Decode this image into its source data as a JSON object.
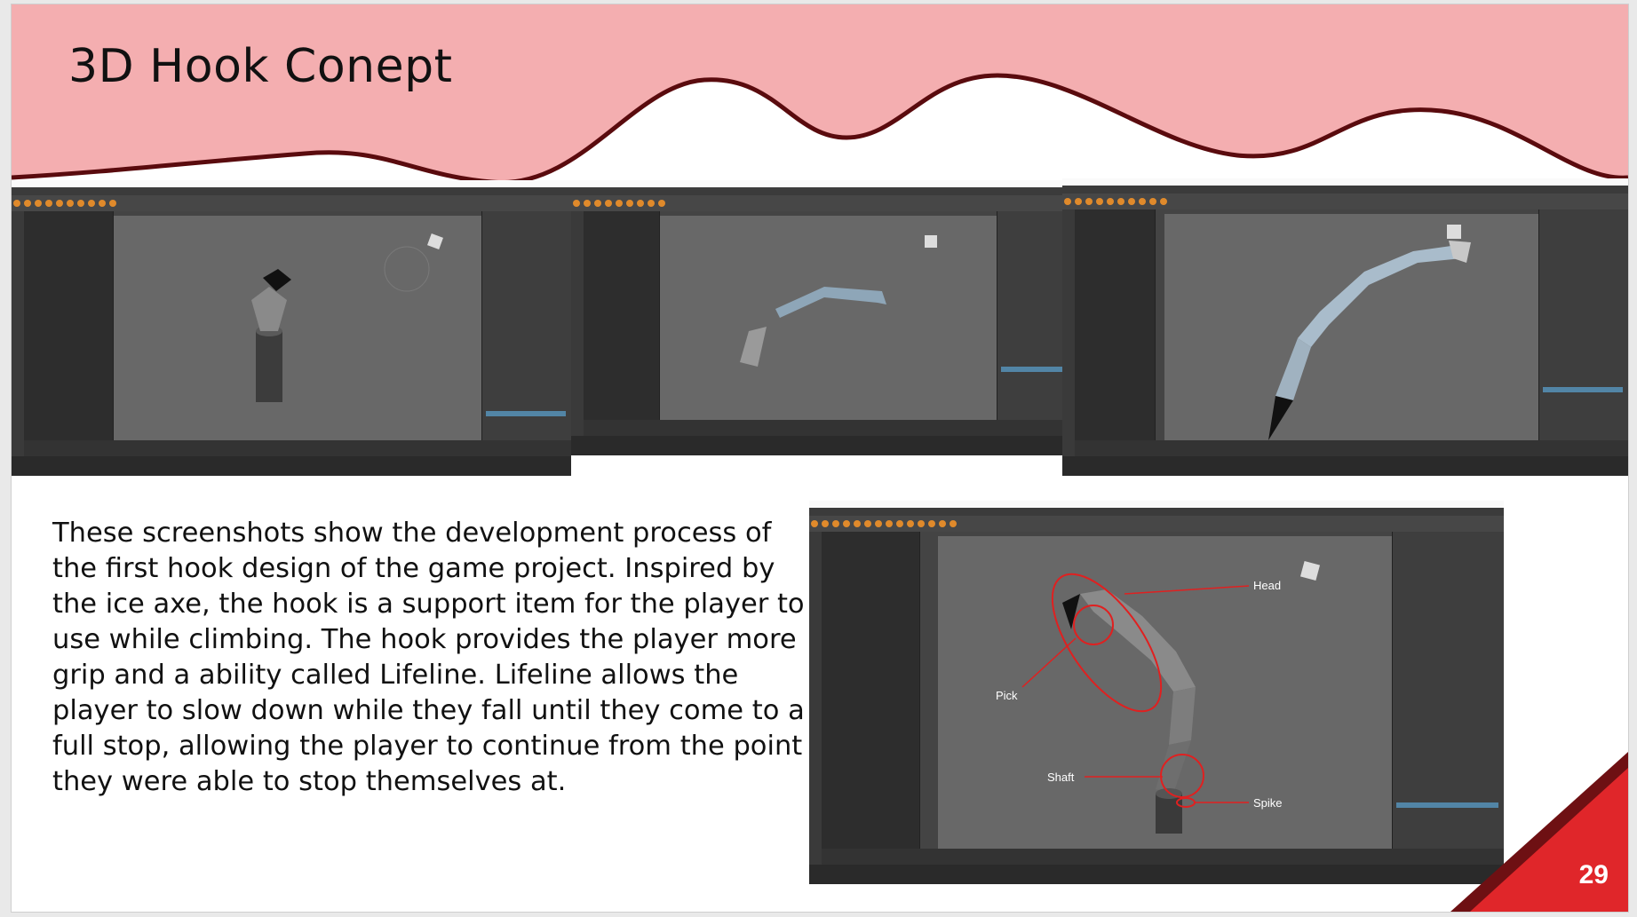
{
  "slide": {
    "title": "3D Hook Conept",
    "body": "These screenshots show the development process of the first hook design of the game project.  Inspired by the ice axe, the hook is a support item for the player to use while climbing. The hook provides the player more grip and a ability called Lifeline. Lifeline allows the player to slow down while they fall until they come to a full stop, allowing the player to continue from the point they were able to stop themselves at.",
    "page_number": "29"
  },
  "annotations": {
    "head": "Head",
    "pick": "Pick",
    "shaft": "Shaft",
    "spike": "Spike"
  },
  "colors": {
    "banner_fill": "#f4aeb0",
    "banner_wave": "#5a0b0e",
    "corner_red": "#e0262a",
    "corner_dark": "#6e1013",
    "annotation_red": "#e02020"
  }
}
